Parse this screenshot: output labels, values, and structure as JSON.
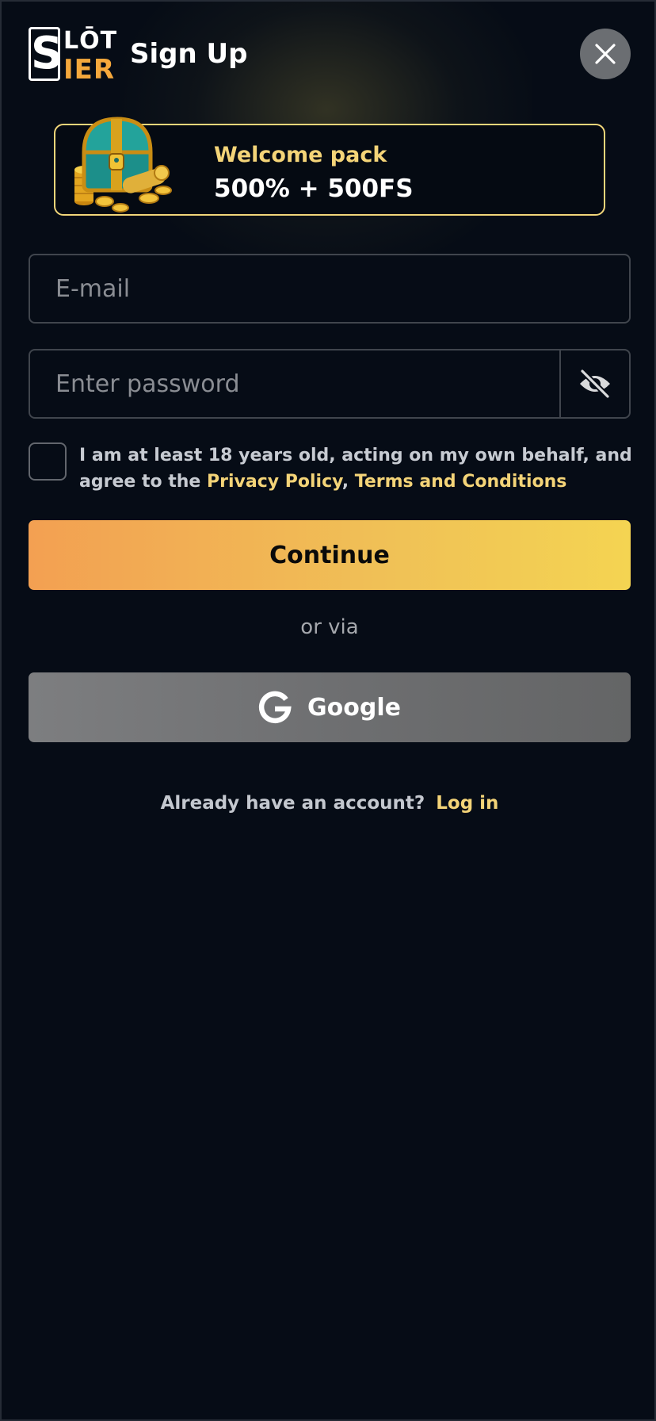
{
  "header": {
    "logo": {
      "letter": "S",
      "top_text": "LŌT",
      "bottom_text": "IER"
    },
    "title": "Sign Up",
    "close_icon": "close-icon"
  },
  "welcome": {
    "title": "Welcome pack",
    "amount": "500% + 500FS",
    "image_icon": "treasure-chest"
  },
  "form": {
    "email_placeholder": "E-mail",
    "password_placeholder": "Enter password",
    "eye_icon": "eye-off-icon",
    "agree_prefix": "I am at least 18 years old, acting on my own behalf, and agree to the ",
    "privacy_link": "Privacy Policy",
    "separator": ", ",
    "terms_link": "Terms and Conditions",
    "continue_label": "Continue"
  },
  "alternatives": {
    "or_via": "or via",
    "google_label": "Google",
    "google_icon": "google-icon"
  },
  "footer": {
    "question": "Already have an account?",
    "login_label": "Log in"
  },
  "colors": {
    "background": "#060c16",
    "accent_yellow": "#f4d478",
    "button_gradient_start": "#f3a052",
    "button_gradient_end": "#f4d452"
  }
}
